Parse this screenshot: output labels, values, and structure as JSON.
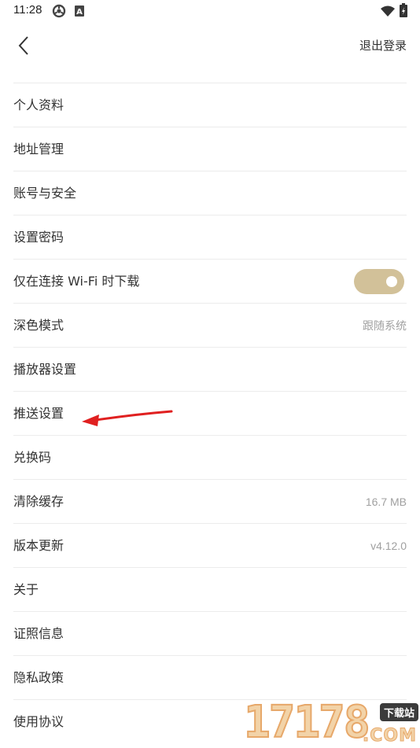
{
  "status_bar": {
    "time": "11:28",
    "icons": [
      "settings-icon",
      "a-badge-icon",
      "wifi-icon",
      "battery-icon"
    ]
  },
  "nav": {
    "back_icon": "chevron-left-icon",
    "logout_label": "退出登录"
  },
  "menu": {
    "items": [
      {
        "label": "个人资料"
      },
      {
        "label": "地址管理"
      },
      {
        "label": "账号与安全"
      },
      {
        "label": "设置密码"
      },
      {
        "label": "仅在连接 Wi-Fi 时下载",
        "toggle_on": true
      },
      {
        "label": "深色模式",
        "value": "跟随系统"
      },
      {
        "label": "播放器设置"
      },
      {
        "label": "推送设置"
      },
      {
        "label": "兑换码"
      },
      {
        "label": "清除缓存",
        "value": "16.7 MB"
      },
      {
        "label": "版本更新",
        "value": "v4.12.0"
      },
      {
        "label": "关于"
      },
      {
        "label": "证照信息"
      },
      {
        "label": "隐私政策"
      },
      {
        "label": "使用协议"
      }
    ]
  },
  "colors": {
    "toggle_active": "#d2c199",
    "annotation_arrow": "#e02020"
  },
  "watermark": {
    "digits": "17178",
    "badge": "下载站",
    "suffix": ".COM"
  }
}
